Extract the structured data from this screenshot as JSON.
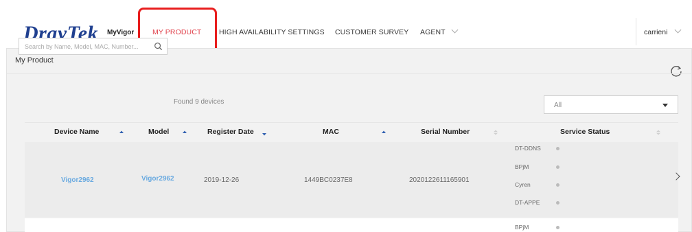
{
  "header": {
    "logo_text": "DrayTek",
    "app_name": "MyVigor",
    "nav": [
      {
        "label": "MY PRODUCT",
        "active": true
      },
      {
        "label": "HIGH AVAILABILITY SETTINGS",
        "active": false
      },
      {
        "label": "CUSTOMER SURVEY",
        "active": false
      },
      {
        "label": "AGENT",
        "active": false,
        "dropdown": true
      }
    ],
    "user": "carrieni"
  },
  "panel": {
    "title": "My Product",
    "search_placeholder": "Search by Name, Model, MAC, Number...",
    "found_text": "Found 9 devices",
    "filter_selected": "All"
  },
  "table": {
    "columns": [
      {
        "label": "Device Name",
        "sort": "asc"
      },
      {
        "label": "Model",
        "sort": "asc"
      },
      {
        "label": "Register Date",
        "sort": "desc"
      },
      {
        "label": "MAC",
        "sort": "asc"
      },
      {
        "label": "Serial Number",
        "sort": "none"
      },
      {
        "label": "Service Status",
        "sort": "none"
      }
    ],
    "rows": [
      {
        "device_name": "Vigor2962",
        "model": "Vigor2962",
        "register_date": "2019-12-26",
        "mac": "1449BC0237E8",
        "serial": "2020122611165901",
        "services": [
          "DT-DDNS",
          "BPjM",
          "Cyren",
          "DT-APPE"
        ]
      },
      {
        "services": [
          "BPjM"
        ]
      }
    ]
  },
  "colors": {
    "brand": "#1f3f8f",
    "active_nav": "#e0404a",
    "highlight": "#e81d1d",
    "link": "#6aaae0"
  }
}
